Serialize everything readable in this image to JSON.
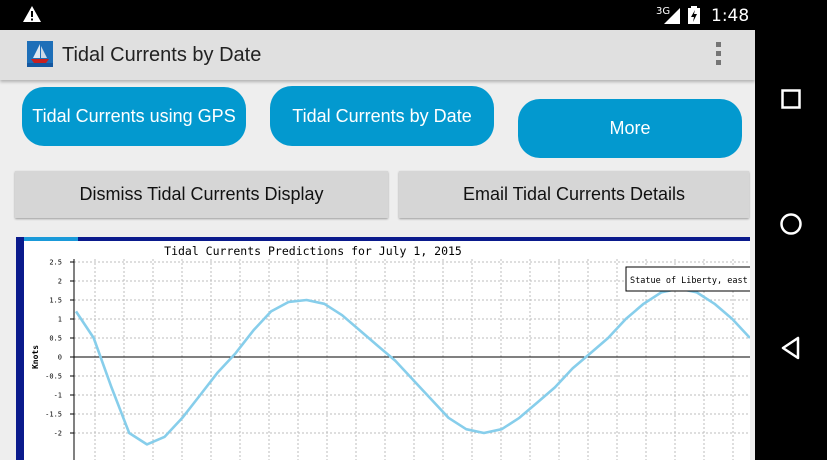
{
  "status_bar": {
    "network": "3G",
    "time": "1:48"
  },
  "action_bar": {
    "title": "Tidal Currents by Date",
    "app_icon": "sailboat-icon",
    "overflow_icon": "overflow-menu-icon"
  },
  "buttons": {
    "gps": "Tidal Currents using GPS",
    "by_date": "Tidal Currents by Date",
    "more": "More",
    "dismiss": "Dismiss Tidal Currents Display",
    "email": "Email Tidal Currents Details"
  },
  "chart_data": {
    "type": "line",
    "title": "Tidal Currents Predictions for July  1, 2015",
    "ylabel": "Knots",
    "ylim": [
      -2.3,
      2.5
    ],
    "yticks": [
      "2.5",
      "2",
      "1.5",
      "1",
      "0.5",
      "0",
      "-0.5",
      "-1",
      "-1.5",
      "-2"
    ],
    "grid": true,
    "legend": "Statue of Liberty, east",
    "legend_position": "top-right",
    "line_color": "#87ceeb",
    "series": [
      {
        "x": [
          0,
          1,
          2,
          3,
          4,
          5,
          6,
          7,
          8,
          9,
          10,
          11,
          12,
          13,
          14,
          15,
          16,
          17,
          18,
          19,
          20,
          21,
          22,
          23,
          24,
          25,
          26,
          27,
          28,
          29,
          30,
          31,
          32,
          33,
          34,
          35,
          36,
          37,
          38
        ],
        "values": [
          1.2,
          0.5,
          -0.8,
          -2.0,
          -2.3,
          -2.1,
          -1.6,
          -1.0,
          -0.4,
          0.1,
          0.7,
          1.2,
          1.45,
          1.5,
          1.4,
          1.1,
          0.7,
          0.3,
          -0.1,
          -0.6,
          -1.1,
          -1.6,
          -1.9,
          -2.0,
          -1.9,
          -1.6,
          -1.2,
          -0.8,
          -0.3,
          0.1,
          0.5,
          1.0,
          1.4,
          1.7,
          1.8,
          1.7,
          1.4,
          1.0,
          0.5
        ]
      }
    ]
  }
}
